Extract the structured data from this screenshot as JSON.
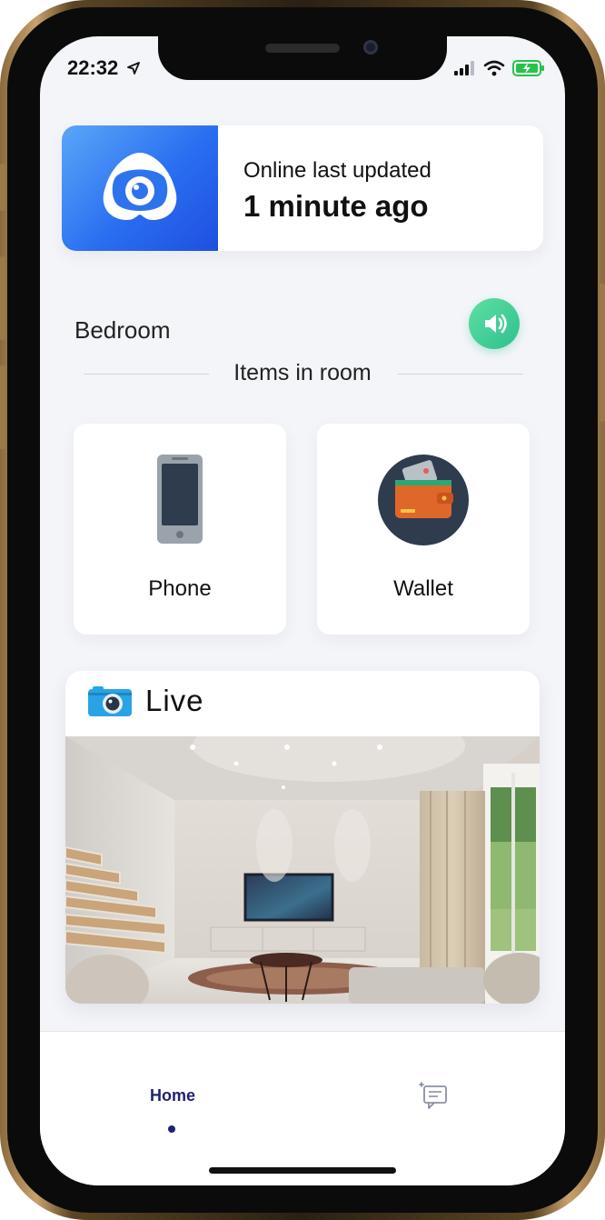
{
  "status_bar": {
    "time": "22:32",
    "icons": [
      "location-arrow-icon",
      "signal-bars-icon",
      "wifi-icon",
      "battery-charging-icon"
    ]
  },
  "status_card": {
    "logo_icon": "eye-logo-icon",
    "line1": "Online  last updated",
    "line2": "1 minute ago",
    "accent_gradient": [
      "#5aa7f7",
      "#1e4fe0"
    ]
  },
  "room": {
    "name": "Bedroom",
    "sound_icon": "speaker-volume-icon",
    "sound_color": "#3ecf96",
    "items_title": "Items in room",
    "items": [
      {
        "label": "Phone",
        "icon": "smartphone-icon"
      },
      {
        "label": "Wallet",
        "icon": "wallet-icon"
      }
    ]
  },
  "live": {
    "icon": "camera-icon",
    "title": "Live"
  },
  "tabbar": {
    "home_label": "Home",
    "home_color": "#1f2370",
    "messages_icon": "add-message-icon"
  }
}
